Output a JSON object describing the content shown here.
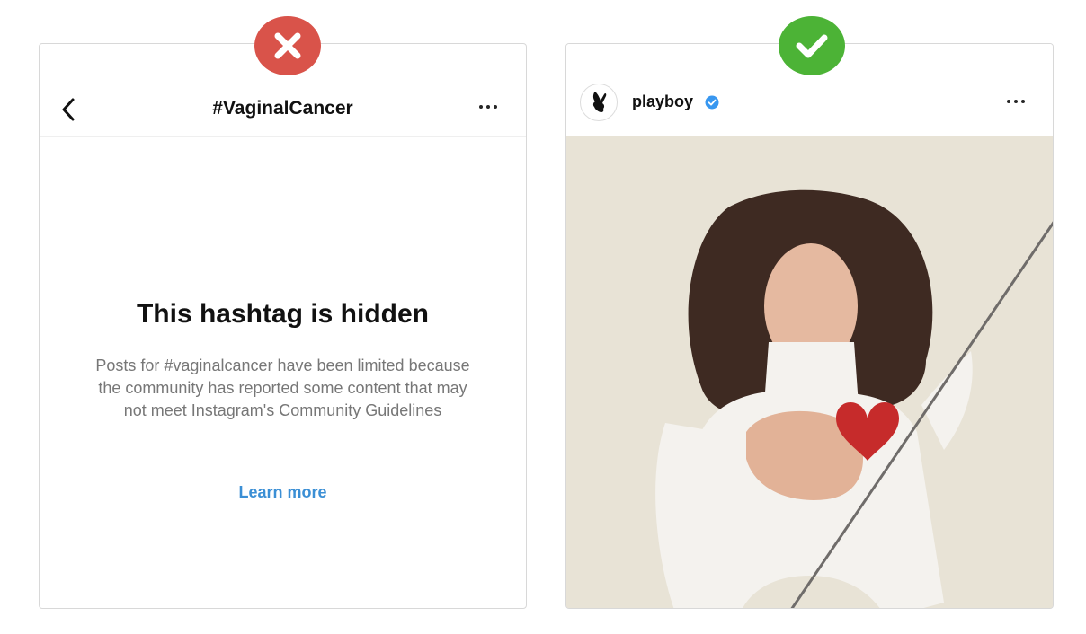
{
  "left_panel": {
    "header": {
      "title": "#VaginalCancer"
    },
    "hidden_title": "This hashtag is hidden",
    "description": "Posts for #vaginalcancer have been limited because the community has reported some content that may not meet Instagram's Community Guidelines",
    "learn_more": "Learn more"
  },
  "right_panel": {
    "username": "playboy",
    "verified": true
  },
  "badges": {
    "bad": {
      "icon": "x-icon",
      "color": "#d9534a"
    },
    "good": {
      "icon": "checkmark-icon",
      "color": "#4cb336"
    }
  },
  "colors": {
    "link": "#3b8fd5",
    "verified": "#3897f0"
  }
}
